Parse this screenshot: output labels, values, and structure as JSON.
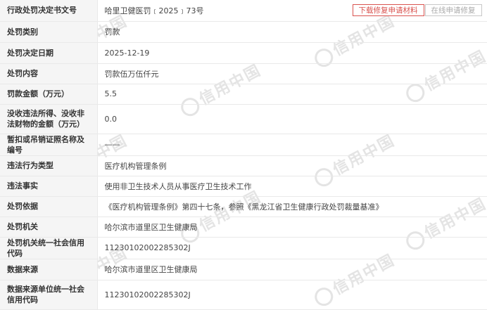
{
  "rows": [
    {
      "label": "行政处罚决定书文号",
      "value": "哈里卫健医罚﹝2025﹞73号"
    },
    {
      "label": "处罚类别",
      "value": "罚款"
    },
    {
      "label": "处罚决定日期",
      "value": "2025-12-19"
    },
    {
      "label": "处罚内容",
      "value": "罚款伍万伍仟元"
    },
    {
      "label": "罚款金额（万元）",
      "value": "5.5"
    },
    {
      "label": "没收违法所得、没收非法财物的金额（万元）",
      "value": "0.0"
    },
    {
      "label": "暂扣或吊销证照名称及编号",
      "value": "——"
    },
    {
      "label": "违法行为类型",
      "value": "医疗机构管理条例"
    },
    {
      "label": "违法事实",
      "value": "使用非卫生技术人员从事医疗卫生技术工作"
    },
    {
      "label": "处罚依据",
      "value": "《医疗机构管理条例》第四十七条，参照《黑龙江省卫生健康行政处罚裁量基准》"
    },
    {
      "label": "处罚机关",
      "value": "哈尔滨市道里区卫生健康局"
    },
    {
      "label": "处罚机关统一社会信用代码",
      "value": "11230102002285302J"
    },
    {
      "label": "数据来源",
      "value": "哈尔滨市道里区卫生健康局"
    },
    {
      "label": "数据来源单位统一社会信用代码",
      "value": "11230102002285302J"
    }
  ],
  "buttons": {
    "download": "下载修复申请材料",
    "online": "在线申请修复"
  },
  "watermark": "信用中国",
  "colors": {
    "label_bg": "#f5f5f5",
    "download_accent": "#d9534f",
    "disabled_text": "#aaaaaa"
  }
}
